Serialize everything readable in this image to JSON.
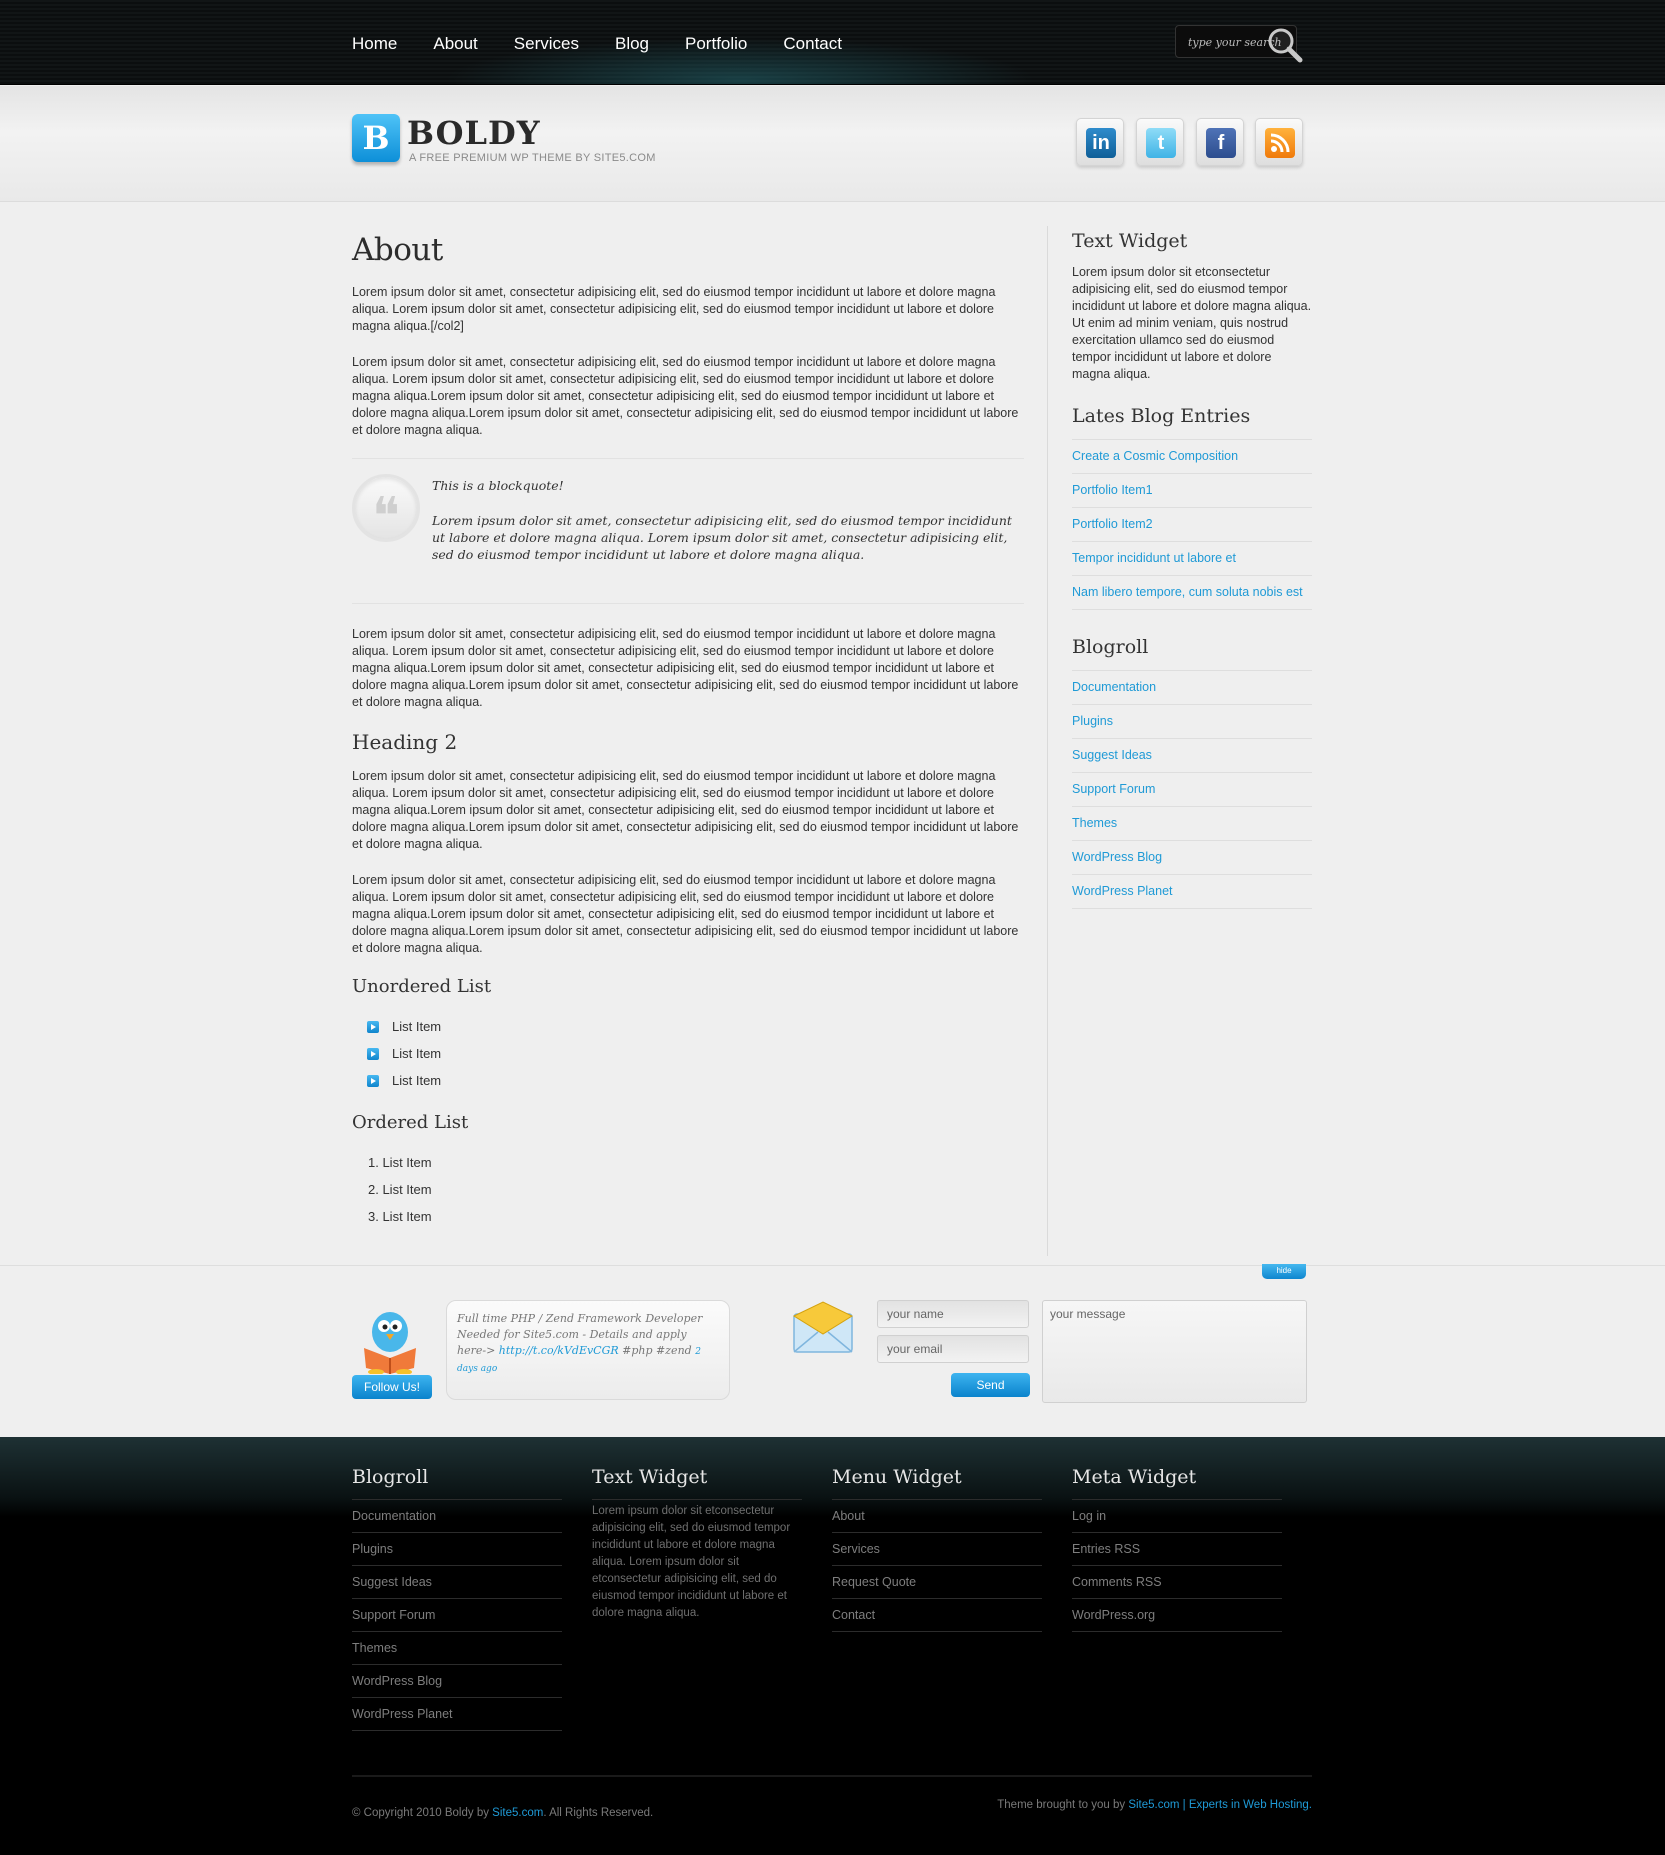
{
  "nav": {
    "items": [
      "Home",
      "About",
      "Services",
      "Blog",
      "Portfolio",
      "Contact"
    ]
  },
  "search": {
    "placeholder": "type your search"
  },
  "logo": {
    "letter": "B",
    "name": "BOLDY",
    "tagline": "A FREE PREMIUM WP THEME BY SITE5.COM"
  },
  "social": {
    "linkedin": "in",
    "twitter": "t",
    "facebook": "f",
    "rss": "rss"
  },
  "page": {
    "title": "About",
    "p1": "Lorem ipsum dolor sit amet, consectetur adipisicing elit, sed do eiusmod tempor incididunt ut labore et dolore magna aliqua. Lorem ipsum dolor sit amet, consectetur adipisicing elit, sed do eiusmod tempor incididunt ut labore et dolore magna aliqua.[/col2]",
    "p2": "Lorem ipsum dolor sit amet, consectetur adipisicing elit, sed do eiusmod tempor incididunt ut labore et dolore magna aliqua. Lorem ipsum dolor sit amet, consectetur adipisicing elit, sed do eiusmod tempor incididunt ut labore et dolore magna aliqua.Lorem ipsum dolor sit amet, consectetur adipisicing elit, sed do eiusmod tempor incididunt ut labore et dolore magna aliqua.Lorem ipsum dolor sit amet, consectetur adipisicing elit, sed do eiusmod tempor incididunt ut labore et dolore magna aliqua.",
    "quote_title": "This is a blockquote!",
    "quote_body": "Lorem ipsum dolor sit amet, consectetur adipisicing elit, sed do eiusmod tempor incididunt ut labore et dolore magna aliqua. Lorem ipsum dolor sit amet, consectetur adipisicing elit, sed do eiusmod tempor incididunt ut labore et dolore magna aliqua.",
    "p3": "Lorem ipsum dolor sit amet, consectetur adipisicing elit, sed do eiusmod tempor incididunt ut labore et dolore magna aliqua. Lorem ipsum dolor sit amet, consectetur adipisicing elit, sed do eiusmod tempor incididunt ut labore et dolore magna aliqua.Lorem ipsum dolor sit amet, consectetur adipisicing elit, sed do eiusmod tempor incididunt ut labore et dolore magna aliqua.Lorem ipsum dolor sit amet, consectetur adipisicing elit, sed do eiusmod tempor incididunt ut labore et dolore magna aliqua.",
    "heading2": "Heading 2",
    "p4": "Lorem ipsum dolor sit amet, consectetur adipisicing elit, sed do eiusmod tempor incididunt ut labore et dolore magna aliqua. Lorem ipsum dolor sit amet, consectetur adipisicing elit, sed do eiusmod tempor incididunt ut labore et dolore magna aliqua.Lorem ipsum dolor sit amet, consectetur adipisicing elit, sed do eiusmod tempor incididunt ut labore et dolore magna aliqua.Lorem ipsum dolor sit amet, consectetur adipisicing elit, sed do eiusmod tempor incididunt ut labore et dolore magna aliqua.",
    "p5": "Lorem ipsum dolor sit amet, consectetur adipisicing elit, sed do eiusmod tempor incididunt ut labore et dolore magna aliqua. Lorem ipsum dolor sit amet, consectetur adipisicing elit, sed do eiusmod tempor incididunt ut labore et dolore magna aliqua.Lorem ipsum dolor sit amet, consectetur adipisicing elit, sed do eiusmod tempor incididunt ut labore et dolore magna aliqua.Lorem ipsum dolor sit amet, consectetur adipisicing elit, sed do eiusmod tempor incididunt ut labore et dolore magna aliqua.",
    "ul_title": "Unordered List",
    "ul_items": [
      "List Item",
      "List Item",
      "List Item"
    ],
    "ol_title": "Ordered List",
    "ol_items": [
      "1.  List Item",
      "2.  List Item",
      "3.  List Item"
    ]
  },
  "sidebar": {
    "text_title": "Text Widget",
    "text_body": "Lorem ipsum dolor sit etconsectetur adipisicing elit, sed do eiusmod tempor incididunt ut labore et dolore magna aliqua. Ut enim ad minim veniam, quis nostrud exercitation ullamco sed do eiusmod tempor incididunt ut labore et dolore magna aliqua.",
    "blog_title": "Lates Blog Entries",
    "blog_items": [
      "Create a Cosmic Composition",
      "Portfolio Item1",
      "Portfolio Item2",
      "Tempor incididunt ut labore et",
      "Nam libero tempore, cum soluta nobis est"
    ],
    "roll_title": "Blogroll",
    "roll_items": [
      "Documentation",
      "Plugins",
      "Suggest Ideas",
      "Support Forum",
      "Themes",
      "WordPress Blog",
      "WordPress Planet"
    ]
  },
  "contact": {
    "hide": "hide",
    "follow": "Follow Us!",
    "tweet_text": "Full time PHP / Zend Framework Developer Needed for Site5.com - Details and apply here-> ",
    "tweet_link": "http://t.co/kVdEvCGR",
    "tweet_tags": " #php #zend ",
    "tweet_ago": "2 days ago",
    "name_ph": "your name",
    "email_ph": "your email",
    "message_ph": "your message",
    "send": "Send"
  },
  "footer": {
    "blogroll_title": "Blogroll",
    "blogroll_items": [
      "Documentation",
      "Plugins",
      "Suggest Ideas",
      "Support Forum",
      "Themes",
      "WordPress Blog",
      "WordPress Planet"
    ],
    "text_title": "Text Widget",
    "text_body": "Lorem ipsum dolor sit etconsectetur adipisicing elit, sed do eiusmod tempor incididunt ut labore et dolore magna aliqua. Lorem ipsum dolor sit etconsectetur adipisicing elit, sed do eiusmod tempor incididunt ut labore et dolore magna aliqua.",
    "menu_title": "Menu Widget",
    "menu_items": [
      "About",
      "Services",
      "Request Quote",
      "Contact"
    ],
    "meta_title": "Meta Widget",
    "meta_items": [
      "Log in",
      "Entries RSS",
      "Comments RSS",
      "WordPress.org"
    ],
    "copy_pre": "© Copyright 2010 Boldy by ",
    "copy_link": "Site5.com",
    "copy_post": ". All Rights Reserved.",
    "credit_pre": "Theme brought to you by ",
    "credit_link": "Site5.com | Experts in Web Hosting."
  },
  "colors": {
    "accent": "#1f9ad6",
    "dark": "#0b0e0f"
  }
}
